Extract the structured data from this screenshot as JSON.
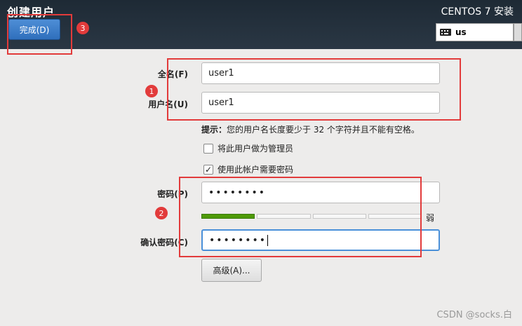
{
  "header": {
    "title": "创建用户",
    "done_label": "完成(D)",
    "app_title": "CENTOS 7 安装",
    "keyboard_layout": "us"
  },
  "form": {
    "fullname_label": "全名(F)",
    "fullname_value": "user1",
    "username_label": "用户名(U)",
    "username_value": "user1",
    "hint_prefix": "提示：",
    "hint_text": "您的用户名长度要少于 32 个字符并且不能有空格。",
    "admin_label": "将此用户做为管理员",
    "admin_checked": false,
    "require_password_label": "使用此帐户需要密码",
    "require_password_checked": true,
    "password_label": "密码(P)",
    "password_value": "••••••••",
    "strength_label": "弱",
    "strength_level": 0.25,
    "confirm_label": "确认密码(C)",
    "confirm_value": "••••••••",
    "advanced_label": "高级(A)..."
  },
  "annotations": {
    "badge1": "1",
    "badge2": "2",
    "badge3": "3",
    "color": "#e23b3b"
  },
  "watermark": "CSDN @socks.白"
}
